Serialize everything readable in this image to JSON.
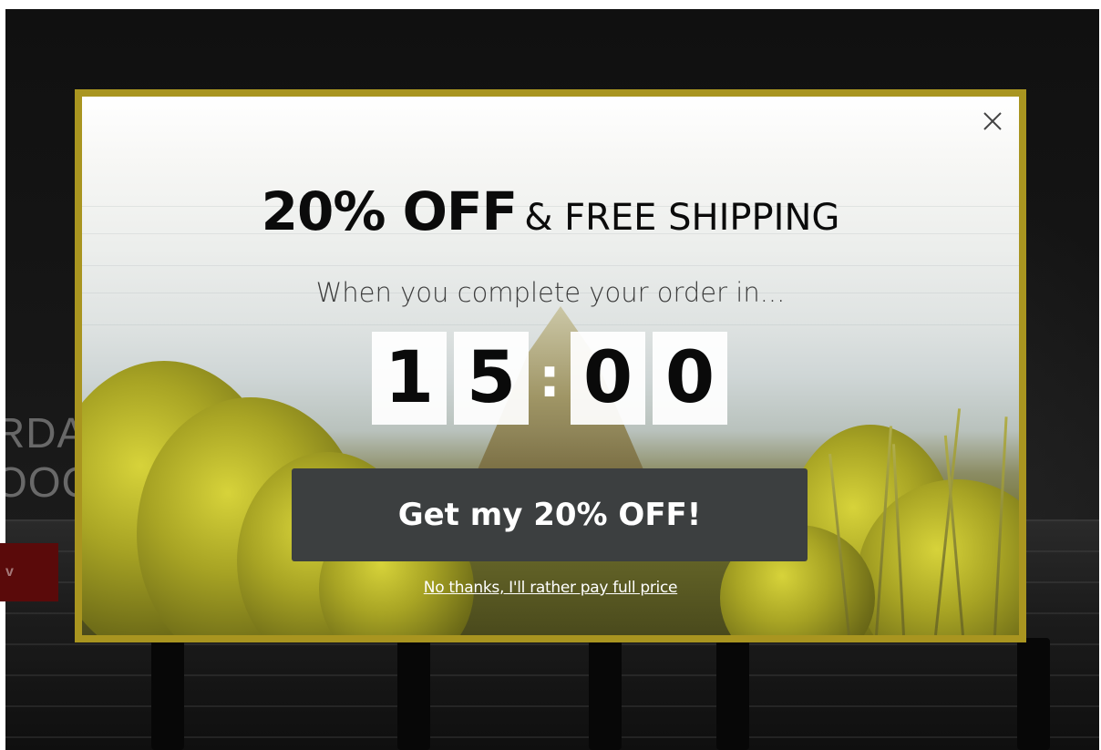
{
  "background_site": {
    "headline_text": "RDA\nOOC",
    "button_label": "v"
  },
  "popup": {
    "close_icon": "close-icon",
    "headline_big": "20% OFF",
    "headline_small": "& FREE SHIPPING",
    "subline": "When you complete your order in...",
    "timer": {
      "minutes_tens": "1",
      "minutes_ones": "5",
      "separator": ":",
      "seconds_tens": "0",
      "seconds_ones": "0"
    },
    "cta_label": "Get my 20% OFF!",
    "decline_label": "No thanks, I'll rather pay full price",
    "colors": {
      "border": "#a99520",
      "cta_background": "#3c3f40",
      "cta_text": "#ffffff",
      "headline": "#0b0b0b"
    }
  }
}
